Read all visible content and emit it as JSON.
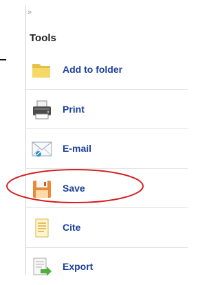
{
  "panel": {
    "collapse_glyph": "»",
    "title": "Tools",
    "items": [
      {
        "label": "Add to folder",
        "icon": "folder-icon"
      },
      {
        "label": "Print",
        "icon": "printer-icon"
      },
      {
        "label": "E-mail",
        "icon": "envelope-icon"
      },
      {
        "label": "Save",
        "icon": "save-icon"
      },
      {
        "label": "Cite",
        "icon": "document-icon"
      },
      {
        "label": "Export",
        "icon": "export-icon"
      }
    ]
  },
  "colors": {
    "link": "#1a3f98",
    "highlight_oval": "#d61f1f"
  }
}
